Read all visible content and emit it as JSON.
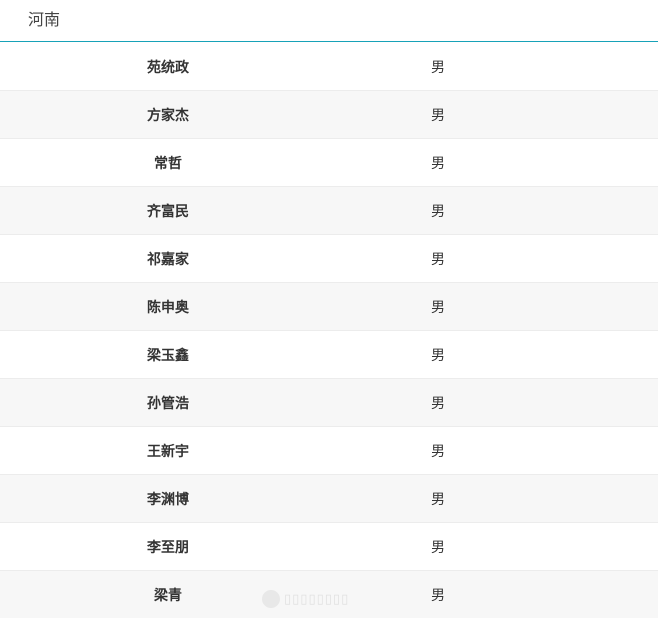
{
  "header": {
    "title": "河南"
  },
  "rows": [
    {
      "name": "苑统政",
      "gender": "男"
    },
    {
      "name": "方家杰",
      "gender": "男"
    },
    {
      "name": "常哲",
      "gender": "男"
    },
    {
      "name": "齐富民",
      "gender": "男"
    },
    {
      "name": "祁嘉家",
      "gender": "男"
    },
    {
      "name": "陈申奥",
      "gender": "男"
    },
    {
      "name": "梁玉鑫",
      "gender": "男"
    },
    {
      "name": "孙管浩",
      "gender": "男"
    },
    {
      "name": "王新宇",
      "gender": "男"
    },
    {
      "name": "李渊博",
      "gender": "男"
    },
    {
      "name": "李至朋",
      "gender": "男"
    },
    {
      "name": "梁青",
      "gender": "男"
    }
  ],
  "colors": {
    "header_rule": "#17a2b8",
    "row_alt_bg": "#f7f7f7",
    "row_border": "#ececec"
  }
}
